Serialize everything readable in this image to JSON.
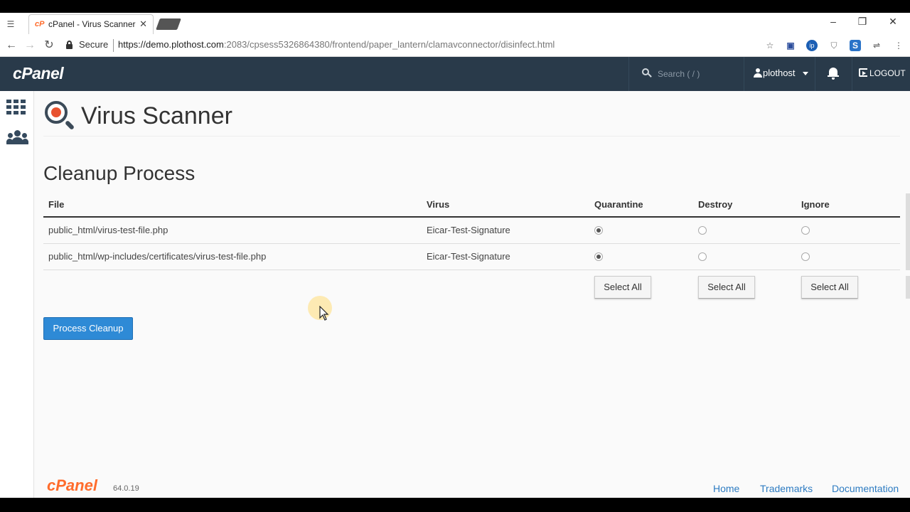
{
  "browser": {
    "tab_title": "cPanel - Virus Scanner",
    "tab_favicon": "cP",
    "secure_label": "Secure",
    "url_scheme": "https://",
    "url_host": "demo.plothost.com",
    "url_rest": ":2083/cpsess5326864380/frontend/paper_lantern/clamavconnector/disinfect.html"
  },
  "header": {
    "logo": "cPanel",
    "search_placeholder": "Search ( / )",
    "username": "plothost",
    "logout": "LOGOUT"
  },
  "page": {
    "title": "Virus Scanner",
    "section_title": "Cleanup Process"
  },
  "table": {
    "columns": [
      "File",
      "Virus",
      "Quarantine",
      "Destroy",
      "Ignore"
    ],
    "rows": [
      {
        "file": "public_html/virus-test-file.php",
        "virus": "Eicar-Test-Signature",
        "selected": "Quarantine"
      },
      {
        "file": "public_html/wp-includes/certificates/virus-test-file.php",
        "virus": "Eicar-Test-Signature",
        "selected": "Quarantine"
      }
    ],
    "select_all_label": "Select All"
  },
  "actions": {
    "process_cleanup": "Process Cleanup"
  },
  "footer": {
    "logo": "cPanel",
    "version": "64.0.19",
    "links": [
      "Home",
      "Trademarks",
      "Documentation"
    ]
  },
  "colors": {
    "header_bg": "#293a4a",
    "brand_orange": "#ff6c2c",
    "primary_button": "#2e8ad6",
    "link": "#2e7cc2"
  }
}
